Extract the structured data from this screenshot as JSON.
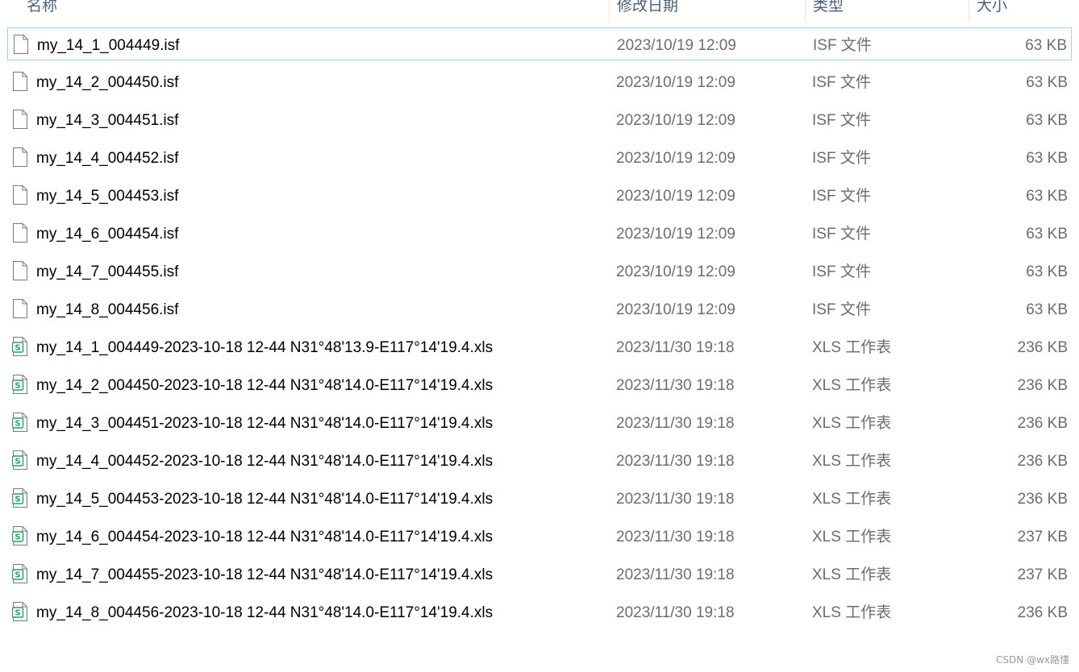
{
  "columns": {
    "name": "名称",
    "date": "修改日期",
    "type": "类型",
    "size": "大小"
  },
  "files": [
    {
      "name": "my_14_1_004449.isf",
      "date": "2023/10/19 12:09",
      "type": "ISF 文件",
      "size": "63 KB",
      "icon": "generic-file-icon"
    },
    {
      "name": "my_14_2_004450.isf",
      "date": "2023/10/19 12:09",
      "type": "ISF 文件",
      "size": "63 KB",
      "icon": "generic-file-icon"
    },
    {
      "name": "my_14_3_004451.isf",
      "date": "2023/10/19 12:09",
      "type": "ISF 文件",
      "size": "63 KB",
      "icon": "generic-file-icon"
    },
    {
      "name": "my_14_4_004452.isf",
      "date": "2023/10/19 12:09",
      "type": "ISF 文件",
      "size": "63 KB",
      "icon": "generic-file-icon"
    },
    {
      "name": "my_14_5_004453.isf",
      "date": "2023/10/19 12:09",
      "type": "ISF 文件",
      "size": "63 KB",
      "icon": "generic-file-icon"
    },
    {
      "name": "my_14_6_004454.isf",
      "date": "2023/10/19 12:09",
      "type": "ISF 文件",
      "size": "63 KB",
      "icon": "generic-file-icon"
    },
    {
      "name": "my_14_7_004455.isf",
      "date": "2023/10/19 12:09",
      "type": "ISF 文件",
      "size": "63 KB",
      "icon": "generic-file-icon"
    },
    {
      "name": "my_14_8_004456.isf",
      "date": "2023/10/19 12:09",
      "type": "ISF 文件",
      "size": "63 KB",
      "icon": "generic-file-icon"
    },
    {
      "name": "my_14_1_004449-2023-10-18 12-44 N31°48'13.9-E117°14'19.4.xls",
      "date": "2023/11/30 19:18",
      "type": "XLS 工作表",
      "size": "236 KB",
      "icon": "spreadsheet-file-icon"
    },
    {
      "name": "my_14_2_004450-2023-10-18 12-44 N31°48'14.0-E117°14'19.4.xls",
      "date": "2023/11/30 19:18",
      "type": "XLS 工作表",
      "size": "236 KB",
      "icon": "spreadsheet-file-icon"
    },
    {
      "name": "my_14_3_004451-2023-10-18 12-44 N31°48'14.0-E117°14'19.4.xls",
      "date": "2023/11/30 19:18",
      "type": "XLS 工作表",
      "size": "236 KB",
      "icon": "spreadsheet-file-icon"
    },
    {
      "name": "my_14_4_004452-2023-10-18 12-44 N31°48'14.0-E117°14'19.4.xls",
      "date": "2023/11/30 19:18",
      "type": "XLS 工作表",
      "size": "236 KB",
      "icon": "spreadsheet-file-icon"
    },
    {
      "name": "my_14_5_004453-2023-10-18 12-44 N31°48'14.0-E117°14'19.4.xls",
      "date": "2023/11/30 19:18",
      "type": "XLS 工作表",
      "size": "236 KB",
      "icon": "spreadsheet-file-icon"
    },
    {
      "name": "my_14_6_004454-2023-10-18 12-44 N31°48'14.0-E117°14'19.4.xls",
      "date": "2023/11/30 19:18",
      "type": "XLS 工作表",
      "size": "237 KB",
      "icon": "spreadsheet-file-icon"
    },
    {
      "name": "my_14_7_004455-2023-10-18 12-44 N31°48'14.0-E117°14'19.4.xls",
      "date": "2023/11/30 19:18",
      "type": "XLS 工作表",
      "size": "237 KB",
      "icon": "spreadsheet-file-icon"
    },
    {
      "name": "my_14_8_004456-2023-10-18 12-44 N31°48'14.0-E117°14'19.4.xls",
      "date": "2023/11/30 19:18",
      "type": "XLS 工作表",
      "size": "236 KB",
      "icon": "spreadsheet-file-icon"
    }
  ],
  "watermark": "CSDN @wx路懂",
  "colors": {
    "header_text": "#4c607a",
    "secondary_text": "#6d6d6d",
    "focus_border": "#99d1ff",
    "spreadsheet_green": "#21a366"
  }
}
